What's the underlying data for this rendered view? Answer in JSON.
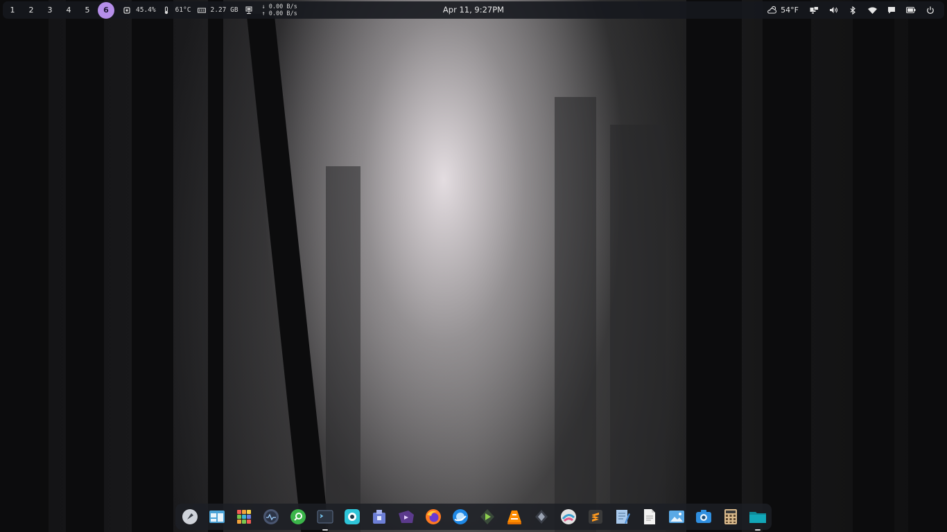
{
  "workspaces": [
    {
      "label": "1",
      "active": false
    },
    {
      "label": "2",
      "active": false
    },
    {
      "label": "3",
      "active": false
    },
    {
      "label": "4",
      "active": false
    },
    {
      "label": "5",
      "active": false
    },
    {
      "label": "6",
      "active": true
    }
  ],
  "stats": {
    "cpu": "45.4%",
    "temperature": "61°C",
    "memory": "2.27 GB",
    "net_down": "↓ 0.00 B/s",
    "net_up": "↑ 0.00 B/s"
  },
  "clock": "Apr 11, 9:27PM",
  "weather": {
    "temp": "54°F",
    "icon": "cloud-sun-icon"
  },
  "tray": [
    "display-icon",
    "volume-icon",
    "bluetooth-icon",
    "wifi-icon",
    "notification-icon",
    "battery-icon",
    "power-icon"
  ],
  "dock": [
    {
      "name": "launcher-rocket-icon",
      "color": "#d8dce2"
    },
    {
      "name": "window-manager-icon",
      "color": "#4aa3d8"
    },
    {
      "name": "app-grid-icon",
      "color": "#f2a23a"
    },
    {
      "name": "system-monitor-icon",
      "color": "#6b7a99"
    },
    {
      "name": "search-app-icon",
      "color": "#3bb54a"
    },
    {
      "name": "terminal-icon",
      "color": "#2b3340",
      "running": true
    },
    {
      "name": "screenshot-tool-icon",
      "color": "#2ec4d8"
    },
    {
      "name": "package-installer-icon",
      "color": "#6d7fd6"
    },
    {
      "name": "video-player-icon",
      "color": "#5b3a8c"
    },
    {
      "name": "firefox-icon",
      "color": "#ff7a22"
    },
    {
      "name": "browser-icon",
      "color": "#1e88e5"
    },
    {
      "name": "media-app-icon",
      "color": "#3a4a3a"
    },
    {
      "name": "vlc-icon",
      "color": "#ff8c00"
    },
    {
      "name": "settings-app-icon",
      "color": "#3b3f48"
    },
    {
      "name": "image-viewer-icon",
      "color": "#e2e2e2"
    },
    {
      "name": "sublime-text-icon",
      "color": "#3a3a3a"
    },
    {
      "name": "text-editor-icon",
      "color": "#4a8ed8"
    },
    {
      "name": "document-icon",
      "color": "#f2f2f2"
    },
    {
      "name": "photo-viewer-icon",
      "color": "#5aa9e6"
    },
    {
      "name": "camera-app-icon",
      "color": "#2f8fe0"
    },
    {
      "name": "calculator-icon",
      "color": "#d9b98b"
    },
    {
      "name": "file-manager-icon",
      "color": "#12a7b8",
      "running": true
    }
  ]
}
